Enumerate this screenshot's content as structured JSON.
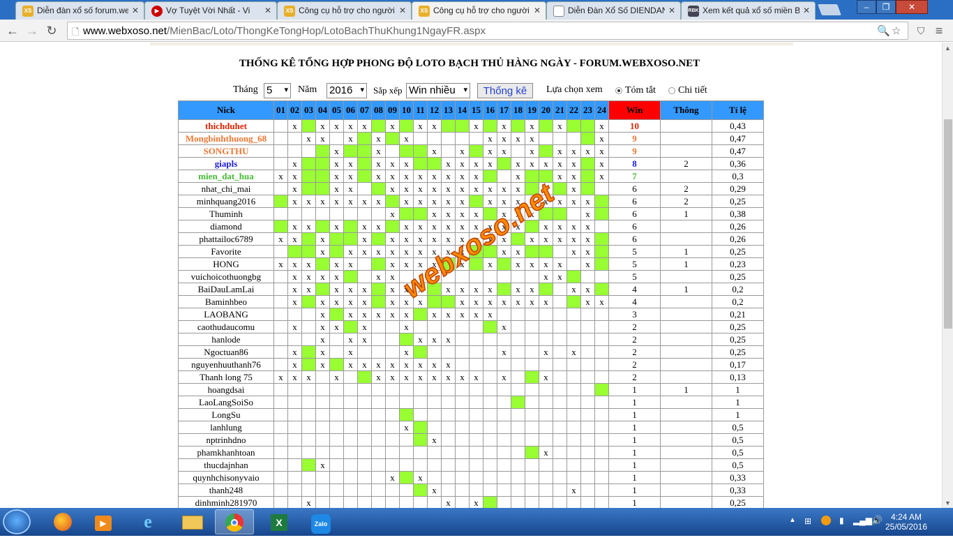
{
  "browser": {
    "tabs": [
      {
        "label": "Diễn đàn xổ số forum.we",
        "icon": "xs-icon",
        "active": false
      },
      {
        "label": "Vợ Tuyệt Vời Nhất - Vi",
        "icon": "youtube-icon",
        "active": false
      },
      {
        "label": "Công cụ hỗ trợ cho người",
        "icon": "xs-icon",
        "active": false
      },
      {
        "label": "Công cụ hỗ trợ cho người",
        "icon": "xs-icon",
        "active": true
      },
      {
        "label": "Diễn Đàn Xổ Số DIENDAN",
        "icon": "page-icon",
        "active": false
      },
      {
        "label": "Xem kết quả xổ số miền B",
        "icon": "rbk-icon",
        "active": false
      }
    ],
    "url": "www.webxoso.net/MienBac/Loto/ThongKeTongHop/LotoBachThuKhung1NgayFR.aspx",
    "url_domain": "www.webxoso.net",
    "url_path": "/MienBac/Loto/ThongKeTongHop/LotoBachThuKhung1NgayFR.aspx"
  },
  "page": {
    "title": "THỐNG KÊ TỔNG HỢP PHONG ĐỘ LOTO BẠCH THỦ HÀNG NGÀY - FORUM.WEBXOSO.NET",
    "controls": {
      "month_label": "Tháng",
      "month_value": "5",
      "year_label": "Năm",
      "year_value": "2016",
      "sort_label": "Sắp xếp",
      "sort_value": "Win nhiều",
      "submit_label": "Thống kê",
      "view_label": "Lựa chọn xem",
      "view_option_1": "Tóm tắt",
      "view_option_2": "Chi tiết",
      "view_selected": "Tóm tắt"
    },
    "watermark": "webxoso.net",
    "table": {
      "headers": {
        "nick": "Nick",
        "days": [
          "01",
          "02",
          "03",
          "04",
          "05",
          "06",
          "07",
          "08",
          "09",
          "10",
          "11",
          "12",
          "13",
          "14",
          "15",
          "16",
          "17",
          "18",
          "19",
          "20",
          "21",
          "22",
          "23",
          "24"
        ],
        "win": "Win",
        "thong": "Thông",
        "rate": "Tỉ lệ"
      },
      "colors": {
        "header": "#3399ff",
        "win_header": "#ff0000",
        "hit": "#99ff33"
      },
      "legend": {
        "x": "x",
        "g": "hit (green cell)",
        "blank": "no pick"
      },
      "rows": [
        {
          "nick": "thichduhet",
          "color": "#dd2200",
          "bold": true,
          "cells": "_xgxxxxgxgxxggxgxgxgxggx",
          "win": "10",
          "thong": "",
          "rate": "0,43"
        },
        {
          "nick": "Mongbinhthuong_68",
          "color": "#ee7733",
          "bold": true,
          "cells": "__xx_xgxgx_____xxxx___gx",
          "win": "9",
          "thong": "",
          "rate": "0,47"
        },
        {
          "nick": "SONGTHU",
          "color": "#ee7733",
          "bold": true,
          "cells": "___gxggx_ggx_xgxx_xgxxxx",
          "win": "9",
          "thong": "",
          "rate": "0,47"
        },
        {
          "nick": "giapls",
          "color": "#1a1add",
          "bold": true,
          "cells": "_xggxxgxxxggxxxxgxxxxxgx",
          "win": "8",
          "thong": "2",
          "rate": "0,36"
        },
        {
          "nick": "mien_dat_hua",
          "color": "#44bb33",
          "bold": true,
          "cells": "xxggxxgxxxxxxxxg_xggxxgx",
          "win": "7",
          "thong": "",
          "rate": "0,3"
        },
        {
          "nick": "nhat_chi_mai",
          "color": "#000",
          "bold": false,
          "cells": "_xggxx_gxxxxxxxxxxgxgxg_",
          "win": "6",
          "thong": "2",
          "rate": "0,29"
        },
        {
          "nick": "minhquang2016",
          "color": "#000",
          "bold": false,
          "cells": "gxxxxxxxgxxxxxgxxxxxxxxg",
          "win": "6",
          "thong": "2",
          "rate": "0,25"
        },
        {
          "nick": "Thuminh",
          "color": "#000",
          "bold": false,
          "cells": "________xggxxxxgxxxgg_xg",
          "win": "6",
          "thong": "1",
          "rate": "0,38"
        },
        {
          "nick": "diamond",
          "color": "#000",
          "bold": false,
          "cells": "gxxgxgxxgxxxxxxxxxgxxxx_",
          "win": "6",
          "thong": "",
          "rate": "0,26"
        },
        {
          "nick": "phattailoc6789",
          "color": "#000",
          "bold": false,
          "cells": "xxgxggxgxxxxxxxxxgxxxxxg",
          "win": "6",
          "thong": "",
          "rate": "0,26"
        },
        {
          "nick": "Favorite",
          "color": "#000",
          "bold": false,
          "cells": "_ggxgxxxxxxxxxggxxgg_xxg",
          "win": "5",
          "thong": "1",
          "rate": "0,25"
        },
        {
          "nick": "HONG",
          "color": "#000",
          "bold": false,
          "cells": "xxxgxx_gxxxxgxgxgxxxx_xg",
          "win": "5",
          "thong": "1",
          "rate": "0,23"
        },
        {
          "nick": "vuichoicothuongbg",
          "color": "#000",
          "bold": false,
          "cells": "_xxxxg_xx__________xxg__",
          "win": "5",
          "thong": "",
          "rate": "0,25"
        },
        {
          "nick": "BaiDauLamLai",
          "color": "#000",
          "bold": false,
          "cells": "_xxgxxxgxxxgxxxxgxxg_xxg",
          "win": "4",
          "thong": "1",
          "rate": "0,2"
        },
        {
          "nick": "Baminhbeo",
          "color": "#000",
          "bold": false,
          "cells": "_xgxxxxgxxxggxxxxxxx_gxx",
          "win": "4",
          "thong": "",
          "rate": "0,2"
        },
        {
          "nick": "LAOBANG",
          "color": "#000",
          "bold": false,
          "cells": "___xgxxxxxgxxxxx________",
          "win": "3",
          "thong": "",
          "rate": "0,21"
        },
        {
          "nick": "caothudaucomu",
          "color": "#000",
          "bold": false,
          "cells": "_x_xxgx__x_____gx_______",
          "win": "2",
          "thong": "",
          "rate": "0,25"
        },
        {
          "nick": "hanlode",
          "color": "#000",
          "bold": false,
          "cells": "___x_xx__gxxx___________",
          "win": "2",
          "thong": "",
          "rate": "0,25"
        },
        {
          "nick": "Ngoctuan86",
          "color": "#000",
          "bold": false,
          "cells": "_xgx_x___xg_____x__x_x__",
          "win": "2",
          "thong": "",
          "rate": "0,25"
        },
        {
          "nick": "nguyenhuuthanh76",
          "color": "#000",
          "bold": false,
          "cells": "_xgxgxxxxxxxx___________",
          "win": "2",
          "thong": "",
          "rate": "0,17"
        },
        {
          "nick": "Thanh long 75",
          "color": "#000",
          "bold": false,
          "cells": "xxx_x_gxxxxxxxx_x_gx____",
          "win": "2",
          "thong": "",
          "rate": "0,13"
        },
        {
          "nick": "hoangdsai",
          "color": "#000",
          "bold": false,
          "cells": "_______________________g",
          "win": "1",
          "thong": "1",
          "rate": "1"
        },
        {
          "nick": "LaoLangSoiSo",
          "color": "#000",
          "bold": false,
          "cells": "_________________g______",
          "win": "1",
          "thong": "",
          "rate": "1"
        },
        {
          "nick": "LongSu",
          "color": "#000",
          "bold": false,
          "cells": "_________g______________",
          "win": "1",
          "thong": "",
          "rate": "1"
        },
        {
          "nick": "lanhlung",
          "color": "#000",
          "bold": false,
          "cells": "_________xg_____________",
          "win": "1",
          "thong": "",
          "rate": "0,5"
        },
        {
          "nick": "nptrinhdno",
          "color": "#000",
          "bold": false,
          "cells": "__________gx____________",
          "win": "1",
          "thong": "",
          "rate": "0,5"
        },
        {
          "nick": "phamkhanhtoan",
          "color": "#000",
          "bold": false,
          "cells": "__________________gx____",
          "win": "1",
          "thong": "",
          "rate": "0,5"
        },
        {
          "nick": "thucdajnhan",
          "color": "#000",
          "bold": false,
          "cells": "__gx____________________",
          "win": "1",
          "thong": "",
          "rate": "0,5"
        },
        {
          "nick": "quynhchisonyvaio",
          "color": "#000",
          "bold": false,
          "cells": "________xgx_____________",
          "win": "1",
          "thong": "",
          "rate": "0,33"
        },
        {
          "nick": "thanh248",
          "color": "#000",
          "bold": false,
          "cells": "__________gx_________x__",
          "win": "1",
          "thong": "",
          "rate": "0,33"
        },
        {
          "nick": "dinhminh281970",
          "color": "#000",
          "bold": false,
          "cells": "__x_________x_xg________",
          "win": "1",
          "thong": "",
          "rate": "0,25"
        }
      ]
    }
  },
  "taskbar": {
    "apps": [
      {
        "name": "firefox-icon",
        "active": false
      },
      {
        "name": "media-player-icon",
        "active": false
      },
      {
        "name": "internet-explorer-icon",
        "active": false
      },
      {
        "name": "file-explorer-icon",
        "active": false
      },
      {
        "name": "chrome-icon",
        "active": true
      },
      {
        "name": "excel-icon",
        "active": false
      },
      {
        "name": "zalo-icon",
        "active": false
      }
    ],
    "zalo_text": "Zalo",
    "time": "4:24 AM",
    "date": "25/05/2016"
  }
}
